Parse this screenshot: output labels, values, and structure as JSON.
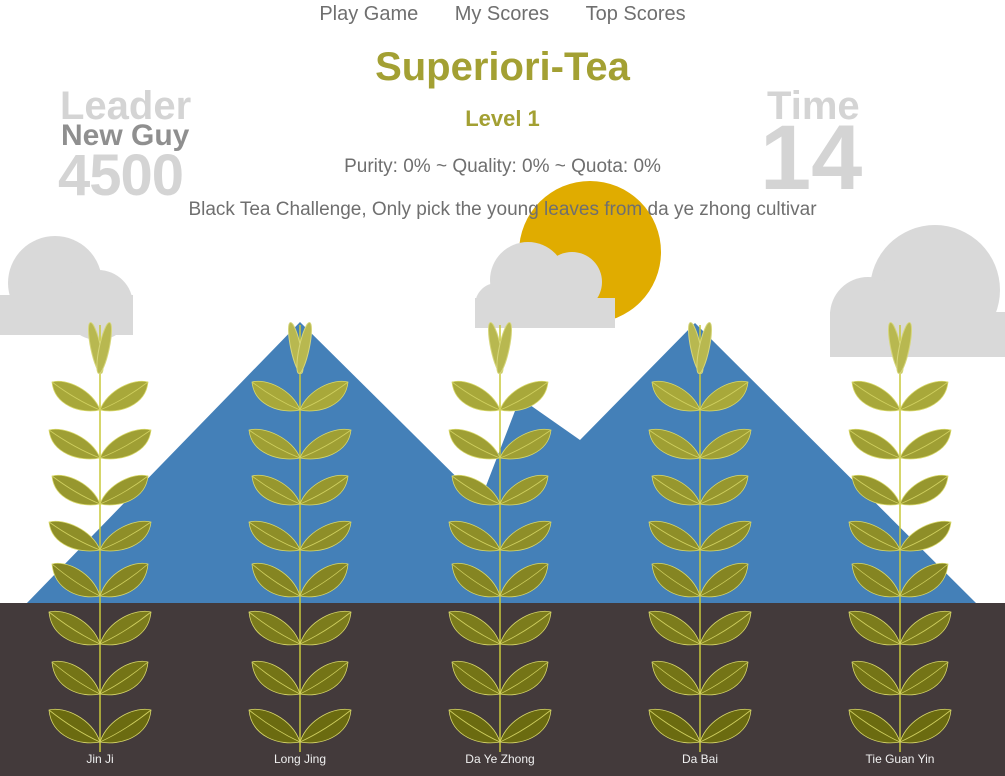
{
  "nav": {
    "play_game": "Play Game",
    "my_scores": "My Scores",
    "top_scores": "Top Scores"
  },
  "game": {
    "title": "Superiori-Tea",
    "level": "Level 1",
    "stats": "Purity: 0% ~ Quality: 0% ~ Quota: 0%",
    "challenge": "Black Tea Challenge, Only pick the young leaves from da ye zhong cultivar"
  },
  "leader": {
    "label": "Leader",
    "name": "New Guy",
    "score": "4500"
  },
  "timer": {
    "label": "Time",
    "value": "14"
  },
  "plants": [
    "Jin Ji",
    "Long Jing",
    "Da Ye Zhong",
    "Da Bai",
    "Tie Guan Yin"
  ],
  "colors": {
    "title": "#a3a033",
    "mountain": "#4480b8",
    "soil": "#433a3b",
    "sun": "#e0ac00",
    "cloud": "#d9d9d9",
    "leaf_young": "#a8a83a",
    "leaf_mature": "#6b6b10"
  }
}
